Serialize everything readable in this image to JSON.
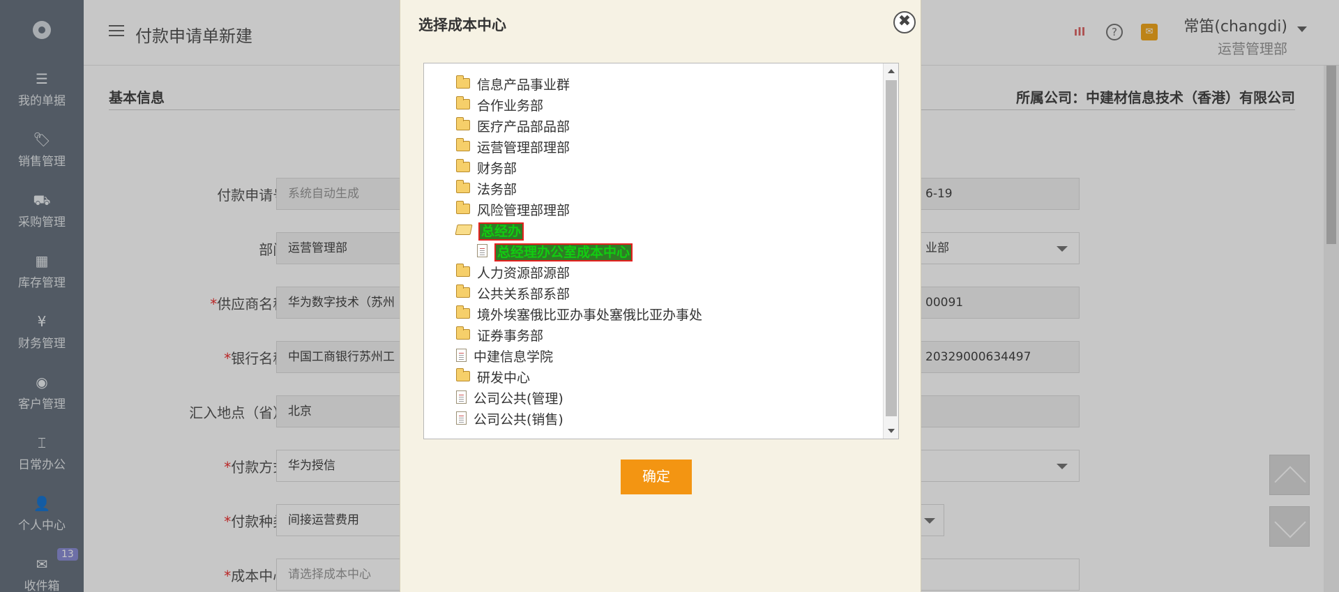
{
  "sidebar": {
    "items": [
      {
        "icon": "document-stack-icon",
        "glyph": "☰",
        "label": "我的单据"
      },
      {
        "icon": "tag-icon",
        "glyph": "🏷",
        "label": "销售管理"
      },
      {
        "icon": "truck-icon",
        "glyph": "⛟",
        "label": "采购管理"
      },
      {
        "icon": "grid-icon",
        "glyph": "▦",
        "label": "库存管理"
      },
      {
        "icon": "yen-icon",
        "glyph": "¥",
        "label": "财务管理"
      },
      {
        "icon": "target-icon",
        "glyph": "◉",
        "label": "客户管理"
      },
      {
        "icon": "office-icon",
        "glyph": "⌶",
        "label": "日常办公"
      },
      {
        "icon": "person-icon",
        "glyph": "👤",
        "label": "个人中心"
      },
      {
        "icon": "mail-icon",
        "glyph": "✉",
        "label": "收件箱",
        "badge": "13"
      }
    ]
  },
  "header": {
    "title": "付款申请单新建",
    "user_name": "常笛(changdi)",
    "user_dept": "运营管理部"
  },
  "section": {
    "title": "基本信息",
    "company": "所属公司：中建材信息技术（香港）有限公司"
  },
  "form": {
    "fields": [
      {
        "label": "付款申请号:",
        "required": false,
        "value": "系统自动生成",
        "right_value": "6-19"
      },
      {
        "label": "部门:",
        "required": false,
        "value": "运营管理部",
        "right_value": "业部"
      },
      {
        "label": "供应商名称:",
        "required": true,
        "value": "华为数字技术（苏州",
        "right_value": "00091"
      },
      {
        "label": "银行名称:",
        "required": true,
        "value": "中国工商银行苏州工",
        "right_value": "20329000634497"
      },
      {
        "label": "汇入地点（省）:",
        "required": false,
        "value": "北京",
        "right_value": ""
      },
      {
        "label": "付款方式:",
        "required": true,
        "value": "华为授信",
        "right_value": ""
      },
      {
        "label": "付款种类:",
        "required": true,
        "value": "间接运营费用",
        "right_value": ""
      },
      {
        "label": "成本中心:",
        "required": true,
        "value": "请选择成本中心",
        "right_value": ""
      }
    ]
  },
  "modal": {
    "title": "选择成本中心",
    "close_label": "✖",
    "confirm_label": "确定",
    "tree": [
      {
        "label": "信息产品事业群",
        "type": "folder",
        "level": 0
      },
      {
        "label": "合作业务部",
        "type": "folder",
        "level": 0
      },
      {
        "label": "医疗产品部品部",
        "type": "folder",
        "level": 0
      },
      {
        "label": "运营管理部理部",
        "type": "folder",
        "level": 0
      },
      {
        "label": "财务部",
        "type": "folder",
        "level": 0
      },
      {
        "label": "法务部",
        "type": "folder",
        "level": 0
      },
      {
        "label": "风险管理部理部",
        "type": "folder",
        "level": 0
      },
      {
        "label": "总经办",
        "type": "folder-open",
        "level": 0,
        "selected": true
      },
      {
        "label": "总经理办公室成本中心",
        "type": "doc",
        "level": 1,
        "selected": true
      },
      {
        "label": "人力资源部源部",
        "type": "folder",
        "level": 0
      },
      {
        "label": "公共关系部系部",
        "type": "folder",
        "level": 0
      },
      {
        "label": "境外埃塞俄比亚办事处塞俄比亚办事处",
        "type": "folder",
        "level": 0
      },
      {
        "label": "证券事务部",
        "type": "folder",
        "level": 0
      },
      {
        "label": "中建信息学院",
        "type": "doc",
        "level": 0
      },
      {
        "label": "研发中心",
        "type": "folder",
        "level": 0
      },
      {
        "label": "公司公共(管理)",
        "type": "doc",
        "level": 0
      },
      {
        "label": "公司公共(销售)",
        "type": "doc",
        "level": 0
      }
    ]
  },
  "colors": {
    "sidebar_bg": "#6a7480",
    "modal_bg": "#f6f2e4",
    "confirm_button": "#f39512",
    "selection_bg": "#2f7c25",
    "selection_border": "#e52020",
    "required_mark": "#e33333"
  }
}
